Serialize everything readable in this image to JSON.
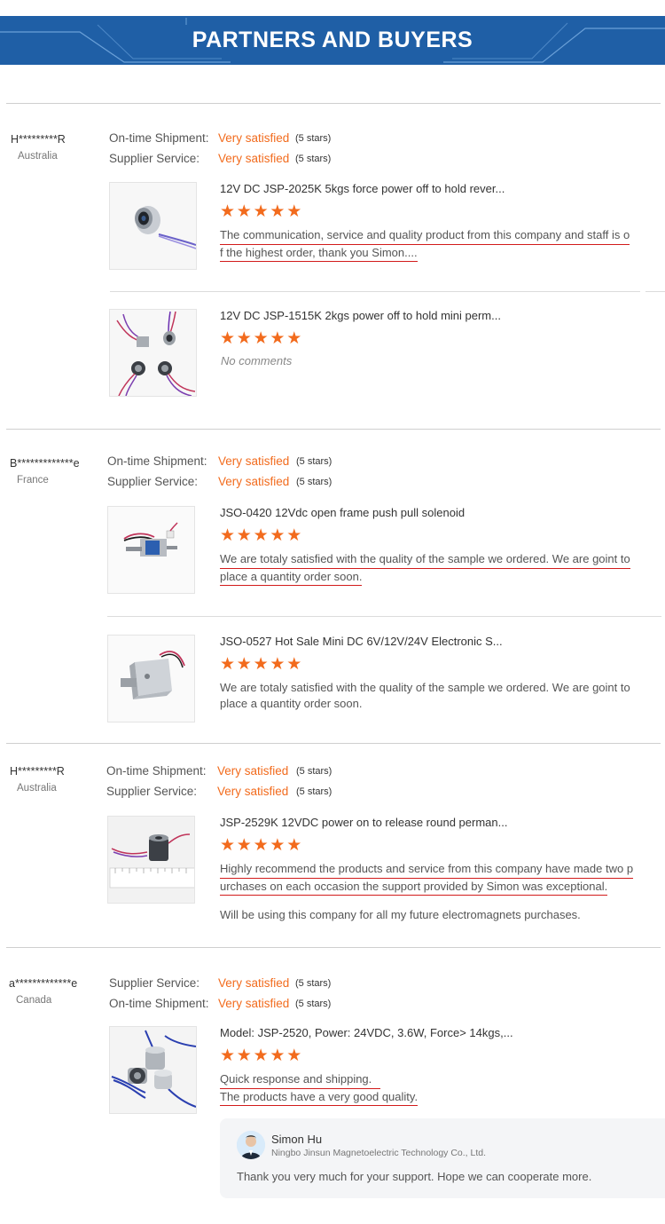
{
  "banner": {
    "title": "PARTNERS AND BUYERS"
  },
  "colors": {
    "banner": "#1f5fa6",
    "accent": "#f26b1d",
    "underline": "#d21b1b"
  },
  "reviews": [
    {
      "buyer": "H*********R",
      "country": "Australia",
      "ratings": [
        {
          "label": "On-time Shipment:",
          "value": "Very satisfied",
          "stars": "(5 stars)"
        },
        {
          "label": "Supplier Service:",
          "value": "Very satisfied",
          "stars": "(5 stars)"
        }
      ],
      "products": [
        {
          "title": "12V DC JSP-2025K 5kgs force power off to hold rever...",
          "thumb": "round-magnet-icon",
          "stars": 5,
          "comment_lines": [
            "The communication, service and quality product from this company and staff is o",
            "f the highest order, thank you Simon...."
          ]
        },
        {
          "title": "12V DC JSP-1515K 2kgs power off to hold mini perm...",
          "thumb": "four-magnets-icon",
          "stars": 5,
          "no_comment": "No comments"
        }
      ]
    },
    {
      "buyer": "B*************e",
      "country": "France",
      "ratings": [
        {
          "label": "On-time Shipment:",
          "value": "Very satisfied",
          "stars": "(5 stars)"
        },
        {
          "label": "Supplier Service:",
          "value": "Very satisfied",
          "stars": "(5 stars)"
        }
      ],
      "products": [
        {
          "title": "JSO-0420 12Vdc open frame push pull solenoid",
          "thumb": "push-pull-solenoid-icon",
          "stars": 5,
          "comment_lines": [
            "We are totaly satisfied with the quality of the sample we ordered. We are goint to",
            "place a quantity order soon."
          ]
        },
        {
          "title": "JSO-0527 Hot Sale Mini DC 6V/12V/24V Electronic S...",
          "thumb": "lock-solenoid-icon",
          "stars": 5,
          "comment_lines": [
            "We are totaly satisfied with the quality of the sample we ordered. We are goint to",
            "place a quantity order soon."
          ]
        }
      ]
    },
    {
      "buyer": "H*********R",
      "country": "Australia",
      "ratings": [
        {
          "label": "On-time Shipment:",
          "value": "Very satisfied",
          "stars": "(5 stars)"
        },
        {
          "label": "Supplier Service:",
          "value": "Very satisfied",
          "stars": "(5 stars)"
        }
      ],
      "products": [
        {
          "title": "JSP-2529K 12VDC power on to release round perman...",
          "thumb": "magnet-with-ruler-icon",
          "stars": 5,
          "comment_lines": [
            "Highly recommend the products and service from this company have made two p",
            "urchases on each occasion the support provided by Simon was exceptional."
          ],
          "extra": "Will be using this company for all my future electromagnets purchases."
        }
      ]
    },
    {
      "buyer": "a*************e",
      "country": "Canada",
      "ratings": [
        {
          "label": "Supplier Service:",
          "value": "Very satisfied",
          "stars": "(5 stars)"
        },
        {
          "label": "On-time Shipment:",
          "value": "Very satisfied",
          "stars": "(5 stars)"
        }
      ],
      "products": [
        {
          "title": "Model: JSP-2520, Power: 24VDC, 3.6W, Force> 14kgs,...",
          "thumb": "two-magnets-icon",
          "stars": 5,
          "comment_lines": [
            "Quick response and shipping.",
            "The products have a very good quality."
          ]
        }
      ]
    }
  ],
  "reply": {
    "name": "Simon Hu",
    "company": "Ningbo Jinsun Magnetoelectric Technology Co., Ltd.",
    "text": "Thank you very much for your support. Hope we can cooperate more."
  }
}
